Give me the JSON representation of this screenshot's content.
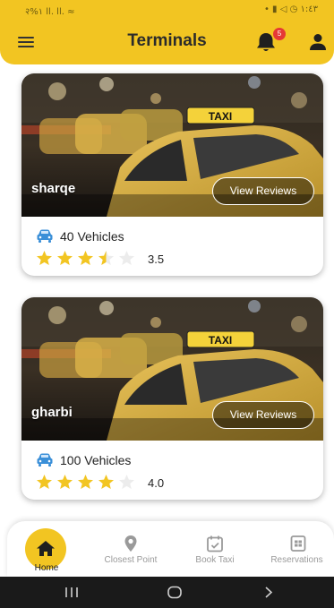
{
  "status_bar": {
    "left": "२%١ ll. ll. ≈",
    "right": "• ▮ ◁ ◷ ١:٤٣"
  },
  "header": {
    "title": "Terminals",
    "notification_count": "5"
  },
  "terminals": [
    {
      "name": "sharqe",
      "reviews_label": "View Reviews",
      "vehicles": "40 Vehicles",
      "rating": 3.5,
      "rating_label": "3.5"
    },
    {
      "name": "gharbi",
      "reviews_label": "View Reviews",
      "vehicles": "100 Vehicles",
      "rating": 4.0,
      "rating_label": "4.0"
    }
  ],
  "taxi_sign": "TAXI",
  "bottom_nav": {
    "items": [
      {
        "label": "Home",
        "icon": "home-icon",
        "active": true
      },
      {
        "label": "Closest Point",
        "icon": "location-pin-icon",
        "active": false
      },
      {
        "label": "Book Taxi",
        "icon": "calendar-check-icon",
        "active": false
      },
      {
        "label": "Reservations",
        "icon": "reservations-icon",
        "active": false
      }
    ]
  },
  "colors": {
    "accent": "#f2c522",
    "star": "#f2c522",
    "badge": "#e53935",
    "car_icon": "#3a8fd8",
    "inactive_nav": "#9a9a9a"
  }
}
